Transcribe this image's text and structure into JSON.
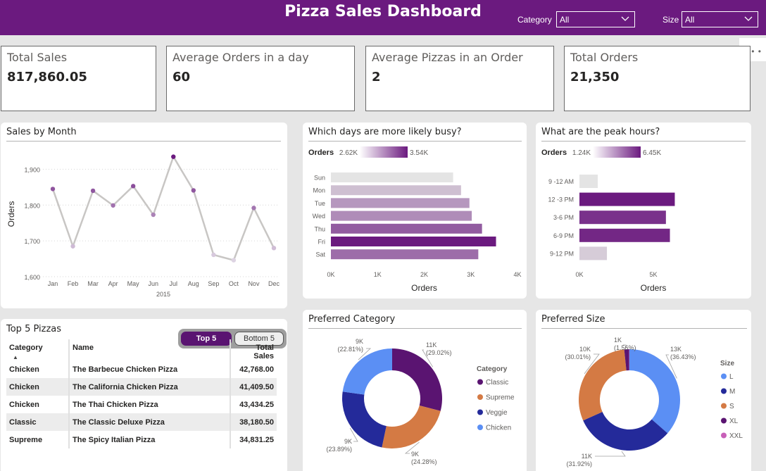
{
  "header": {
    "title": "Pizza Sales Dashboard",
    "category_label": "Category",
    "category_value": "All",
    "size_label": "Size",
    "size_value": "All"
  },
  "kpis": [
    {
      "label": "Total Sales",
      "value": "817,860.05"
    },
    {
      "label": "Average Orders in a day",
      "value": "60"
    },
    {
      "label": "Average Pizzas in an Order",
      "value": "2"
    },
    {
      "label": "Total Orders",
      "value": "21,350"
    }
  ],
  "colors": {
    "accent": "#6b1a7f",
    "line": "#c8c6c4",
    "classic": "#5a1471",
    "supreme": "#d47a44",
    "veggie": "#242a9a",
    "chicken": "#5b8ff4",
    "xxl": "#c75fb8"
  },
  "top5": {
    "title": "Top 5 Pizzas",
    "toggle_on": "Top 5",
    "toggle_off": "Bottom 5",
    "columns": [
      "Category",
      "Name",
      "Total Sales"
    ],
    "rows": [
      [
        "Chicken",
        "The Barbecue Chicken Pizza",
        "42,768.00"
      ],
      [
        "Chicken",
        "The California Chicken Pizza",
        "41,409.50"
      ],
      [
        "Chicken",
        "The Thai Chicken Pizza",
        "43,434.25"
      ],
      [
        "Classic",
        "The Classic Deluxe Pizza",
        "38,180.50"
      ],
      [
        "Supreme",
        "The Spicy Italian Pizza",
        "34,831.25"
      ]
    ]
  },
  "chart_data": [
    {
      "type": "line",
      "title": "Sales by Month",
      "ylabel": "Orders",
      "xlabel": "",
      "x_group_label": "2015",
      "categories": [
        "Jan",
        "Feb",
        "Mar",
        "Apr",
        "May",
        "Jun",
        "Jul",
        "Aug",
        "Sep",
        "Oct",
        "Nov",
        "Dec"
      ],
      "values": [
        1845,
        1685,
        1840,
        1799,
        1853,
        1773,
        1935,
        1841,
        1661,
        1646,
        1792,
        1680
      ],
      "ylim": [
        1600,
        1950
      ],
      "yticks": [
        1600,
        1700,
        1800,
        1900
      ],
      "ytick_labels": [
        "1,600",
        "1,700",
        "1,800",
        "1,900"
      ],
      "grid": true
    },
    {
      "type": "bar",
      "orientation": "horizontal",
      "title": "Which days are more likely busy?",
      "legend_label": "Orders",
      "legend_min": "2.62K",
      "legend_max": "3.54K",
      "xlabel": "Orders",
      "categories": [
        "Sun",
        "Mon",
        "Tue",
        "Wed",
        "Thu",
        "Fri",
        "Sat"
      ],
      "values": [
        2620,
        2790,
        2970,
        3020,
        3240,
        3540,
        3160
      ],
      "xlim": [
        0,
        4000
      ],
      "xticks": [
        0,
        1000,
        2000,
        3000,
        4000
      ],
      "xtick_labels": [
        "0K",
        "1K",
        "2K",
        "3K",
        "4K"
      ]
    },
    {
      "type": "bar",
      "orientation": "horizontal",
      "title": "What are the peak hours?",
      "legend_label": "Orders",
      "legend_min": "1.24K",
      "legend_max": "6.45K",
      "xlabel": "Orders",
      "categories": [
        "9 -12 AM",
        "12 -3 PM",
        "3-6 PM",
        "6-9 PM",
        "9-12 PM"
      ],
      "values": [
        1240,
        6450,
        5850,
        6120,
        1860
      ],
      "xlim": [
        0,
        10000
      ],
      "xticks": [
        0,
        5000
      ],
      "xtick_labels": [
        "0K",
        "5K"
      ]
    },
    {
      "type": "pie",
      "donut": true,
      "title": "Preferred Category",
      "legend_title": "Category",
      "labels": [
        "Classic",
        "Supreme",
        "Veggie",
        "Chicken"
      ],
      "values": [
        29.02,
        24.28,
        23.89,
        22.81
      ],
      "value_labels": [
        "11K",
        "9K",
        "9K",
        "9K"
      ],
      "percent_labels": [
        "(29.02%)",
        "(24.28%)",
        "(23.89%)",
        "(22.81%)"
      ]
    },
    {
      "type": "pie",
      "donut": true,
      "title": "Preferred Size",
      "legend_title": "Size",
      "labels": [
        "L",
        "M",
        "S",
        "XL",
        "XXL"
      ],
      "values": [
        36.43,
        31.92,
        30.01,
        1.56,
        0.08
      ],
      "value_labels": [
        "13K",
        "11K",
        "10K",
        "1K",
        ""
      ],
      "percent_labels": [
        "(36.43%)",
        "(31.92%)",
        "(30.01%)",
        "(1.56%)",
        ""
      ]
    }
  ]
}
